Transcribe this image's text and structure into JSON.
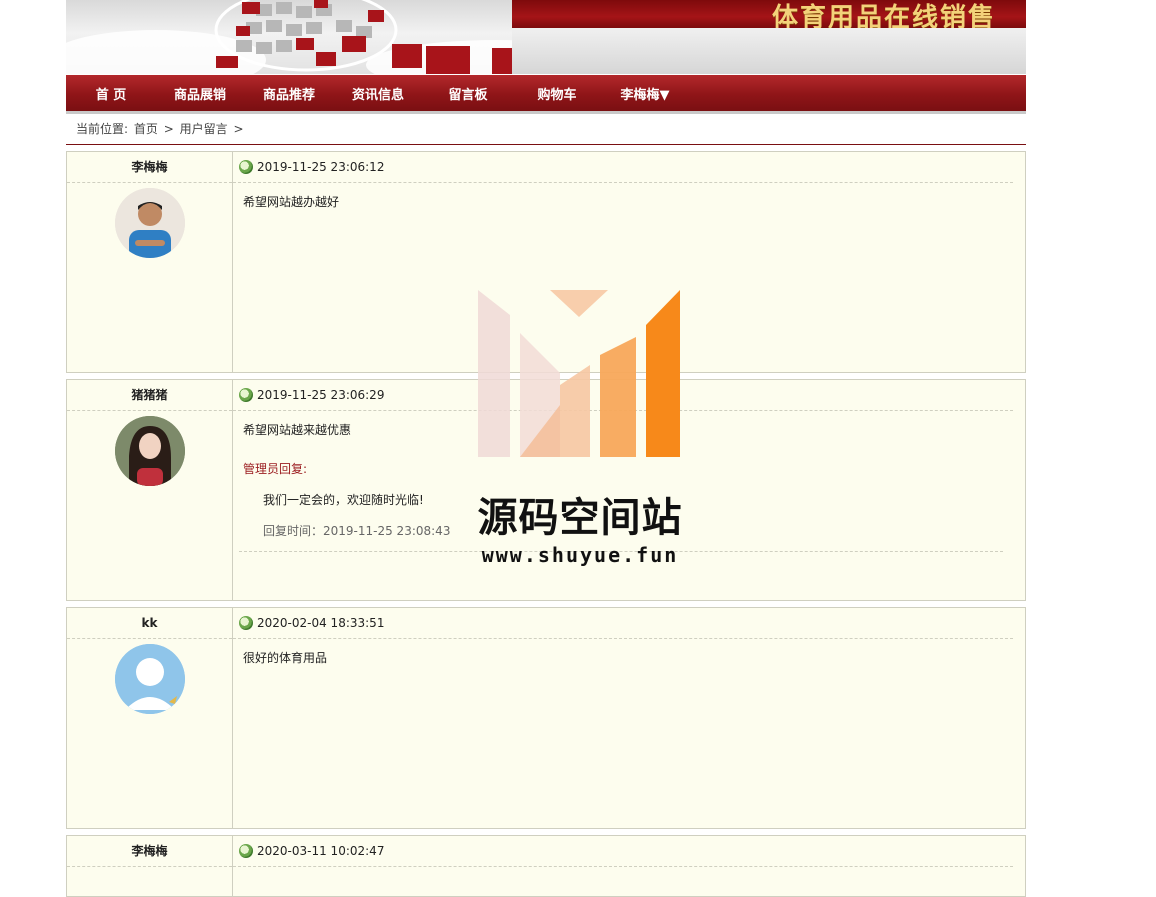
{
  "site": {
    "banner_title": "体育用品在线销售"
  },
  "nav": {
    "items": [
      {
        "label": "首 页"
      },
      {
        "label": "商品展销"
      },
      {
        "label": "商品推荐"
      },
      {
        "label": "资讯信息"
      },
      {
        "label": "留言板"
      },
      {
        "label": "购物车"
      },
      {
        "label": "李梅梅▼"
      }
    ]
  },
  "breadcrumb": {
    "prefix": "当前位置:",
    "home": "首页",
    "sep1": ">",
    "current": "用户留言",
    "sep2": ">"
  },
  "messages": [
    {
      "user": "李梅梅",
      "time": "2019-11-25 23:06:12",
      "content": "希望网站越办越好"
    },
    {
      "user": "猪猪猪",
      "time": "2019-11-25 23:06:29",
      "content": "希望网站越来越优惠",
      "reply_label": "管理员回复:",
      "reply_text": "我们一定会的，欢迎随时光临!",
      "reply_time": "回复时间：2019-11-25 23:08:43"
    },
    {
      "user": "kk",
      "time": "2020-02-04 18:33:51",
      "content": "很好的体育用品"
    },
    {
      "user": "李梅梅",
      "time": "2020-03-11 10:02:47",
      "content": ""
    }
  ],
  "watermark": {
    "title": "源码空间站",
    "url": "www.shuyue.fun"
  },
  "colors": {
    "brand_red": "#8f1518",
    "card_bg": "#fdfdee",
    "reply_red": "#9b1c1f"
  },
  "icons": {
    "time": "clock-icon"
  }
}
